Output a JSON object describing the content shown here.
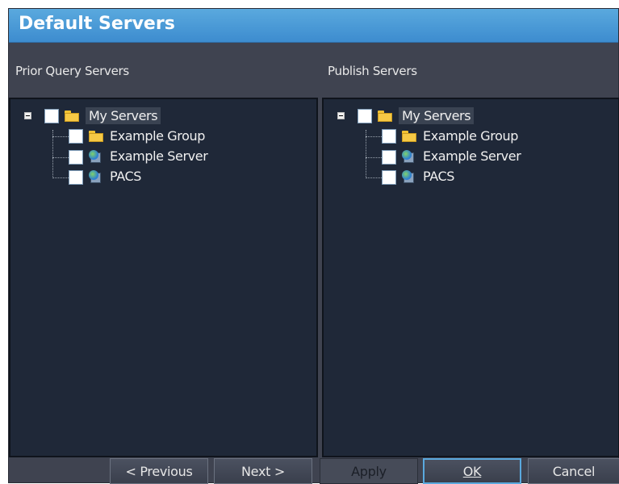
{
  "window": {
    "title": "Default Servers"
  },
  "left_panel": {
    "label": "Prior Query Servers",
    "tree": {
      "root": "My Servers",
      "children": [
        {
          "label": "Example Group",
          "icon": "folder-icon"
        },
        {
          "label": "Example Server",
          "icon": "server-icon"
        },
        {
          "label": "PACS",
          "icon": "server-icon"
        }
      ]
    }
  },
  "right_panel": {
    "label": "Publish Servers",
    "tree": {
      "root": "My Servers",
      "children": [
        {
          "label": "Example Group",
          "icon": "folder-icon"
        },
        {
          "label": "Example Server",
          "icon": "server-icon"
        },
        {
          "label": "PACS",
          "icon": "server-icon"
        }
      ]
    }
  },
  "buttons": {
    "previous": "< Previous",
    "next": "Next >",
    "apply": "Apply",
    "ok": "OK",
    "cancel": "Cancel"
  },
  "colors": {
    "title_bar": "#4a9bd8",
    "window_bg": "#3f4350",
    "panel_bg": "#1f2838",
    "default_button_border": "#5aa9de"
  }
}
